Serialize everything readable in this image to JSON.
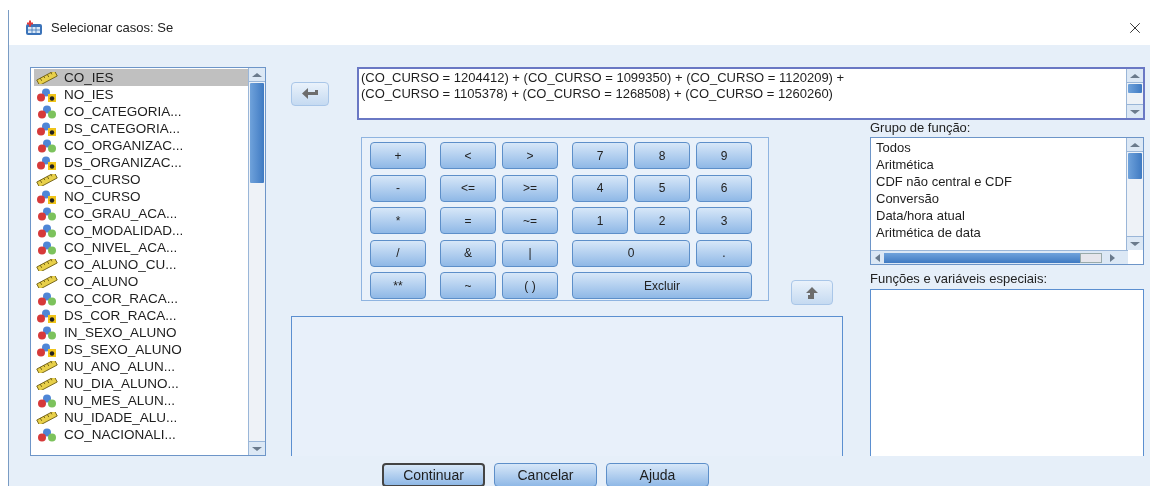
{
  "window": {
    "title": "Selecionar casos: Se"
  },
  "variables": [
    {
      "name": "CO_IES",
      "kind": "scale",
      "selected": true
    },
    {
      "name": "NO_IES",
      "kind": "string",
      "selected": false
    },
    {
      "name": "CO_CATEGORIA...",
      "kind": "nominal",
      "selected": false
    },
    {
      "name": "DS_CATEGORIA...",
      "kind": "string",
      "selected": false
    },
    {
      "name": "CO_ORGANIZAC...",
      "kind": "nominal",
      "selected": false
    },
    {
      "name": "DS_ORGANIZAC...",
      "kind": "string",
      "selected": false
    },
    {
      "name": "CO_CURSO",
      "kind": "scale",
      "selected": false
    },
    {
      "name": "NO_CURSO",
      "kind": "string",
      "selected": false
    },
    {
      "name": "CO_GRAU_ACA...",
      "kind": "nominal",
      "selected": false
    },
    {
      "name": "CO_MODALIDAD...",
      "kind": "nominal",
      "selected": false
    },
    {
      "name": "CO_NIVEL_ACA...",
      "kind": "nominal",
      "selected": false
    },
    {
      "name": "CO_ALUNO_CU...",
      "kind": "scale",
      "selected": false
    },
    {
      "name": "CO_ALUNO",
      "kind": "scale",
      "selected": false
    },
    {
      "name": "CO_COR_RACA...",
      "kind": "nominal",
      "selected": false
    },
    {
      "name": "DS_COR_RACA...",
      "kind": "string",
      "selected": false
    },
    {
      "name": "IN_SEXO_ALUNO",
      "kind": "nominal",
      "selected": false
    },
    {
      "name": "DS_SEXO_ALUNO",
      "kind": "string",
      "selected": false
    },
    {
      "name": "NU_ANO_ALUN...",
      "kind": "scale",
      "selected": false
    },
    {
      "name": "NU_DIA_ALUNO...",
      "kind": "scale",
      "selected": false
    },
    {
      "name": "NU_MES_ALUN...",
      "kind": "nominal",
      "selected": false
    },
    {
      "name": "NU_IDADE_ALU...",
      "kind": "scale",
      "selected": false
    },
    {
      "name": "CO_NACIONALI...",
      "kind": "nominal",
      "selected": false
    }
  ],
  "expression": {
    "lines": [
      "(CO_CURSO = 1204412) + (CO_CURSO = 1099350) + (CO_CURSO = 1120209) +",
      "(CO_CURSO = 1105378) + (CO_CURSO = 1268508) + (CO_CURSO = 1260260)"
    ]
  },
  "keypad": [
    {
      "kind": "operators",
      "keys": [
        {
          "label": "+",
          "kind": "single"
        },
        {
          "label": "-",
          "kind": "single"
        },
        {
          "label": "*",
          "kind": "single"
        },
        {
          "label": "/",
          "kind": "single"
        },
        {
          "label": "**",
          "kind": "single"
        }
      ]
    },
    {
      "kind": "relational",
      "keys": [
        {
          "label": "<",
          "kind": "single"
        },
        {
          "label": ">",
          "kind": "single"
        },
        {
          "label": "<=",
          "kind": "single"
        },
        {
          "label": ">=",
          "kind": "single"
        },
        {
          "label": "=",
          "kind": "single"
        },
        {
          "label": "~=",
          "kind": "single"
        },
        {
          "label": "&",
          "kind": "single"
        },
        {
          "label": "|",
          "kind": "single"
        },
        {
          "label": "~",
          "kind": "single"
        },
        {
          "label": "( )",
          "kind": "single"
        }
      ]
    },
    {
      "kind": "digits",
      "keys": [
        {
          "label": "7",
          "kind": "single"
        },
        {
          "label": "8",
          "kind": "single"
        },
        {
          "label": "9",
          "kind": "single"
        },
        {
          "label": "4",
          "kind": "single"
        },
        {
          "label": "5",
          "kind": "single"
        },
        {
          "label": "6",
          "kind": "single"
        },
        {
          "label": "1",
          "kind": "single"
        },
        {
          "label": "2",
          "kind": "single"
        },
        {
          "label": "3",
          "kind": "single"
        },
        {
          "label": "0",
          "kind": "double"
        },
        {
          "label": ".",
          "kind": "single"
        },
        {
          "label": "Excluir",
          "kind": "triple"
        }
      ]
    }
  ],
  "function_group": {
    "label": "Grupo de função:",
    "items": [
      {
        "label": "Todos",
        "selected": false
      },
      {
        "label": "Aritmética",
        "selected": false
      },
      {
        "label": "CDF não central e CDF",
        "selected": false
      },
      {
        "label": "Conversão",
        "selected": false
      },
      {
        "label": "Data/hora atual",
        "selected": false
      },
      {
        "label": "Aritmética de data",
        "selected": false
      }
    ]
  },
  "special_functions": {
    "label": "Funções e variáveis especiais:"
  },
  "buttons": [
    {
      "label": "Continuar",
      "default": true
    },
    {
      "label": "Cancelar",
      "default": false
    },
    {
      "label": "Ajuda",
      "default": false
    }
  ]
}
